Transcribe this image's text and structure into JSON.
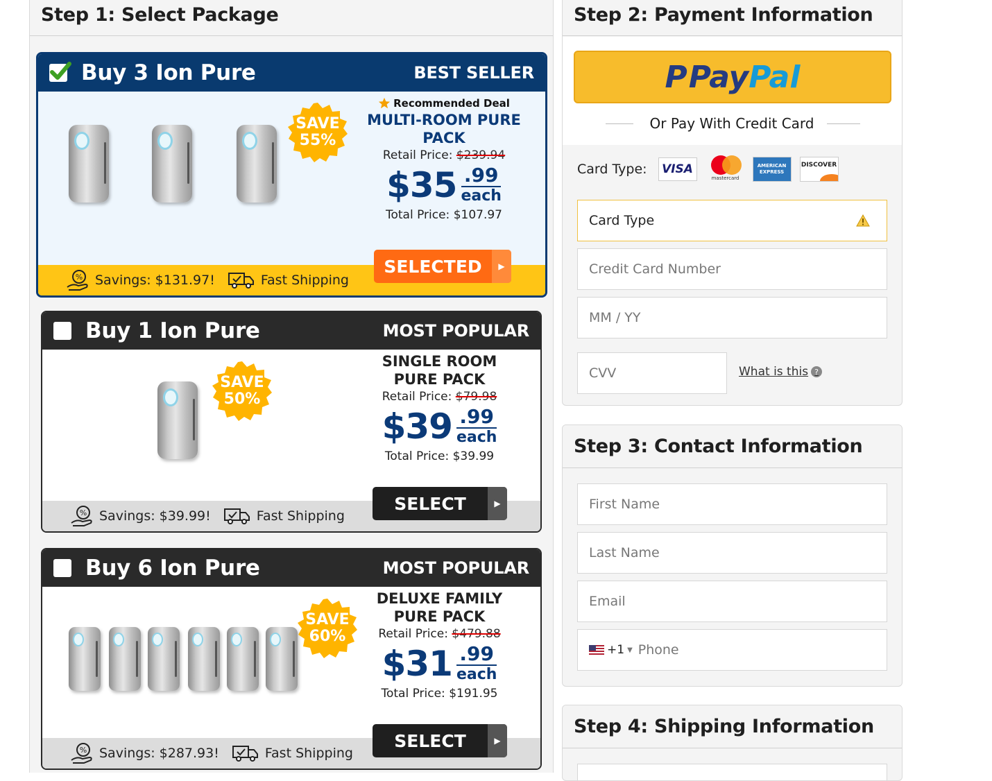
{
  "step1": {
    "title": "Step 1: Select Package"
  },
  "packages": [
    {
      "title": "Buy 3 Ion Pure",
      "tag": "BEST SELLER",
      "recommended": "Recommended Deal",
      "save_line1": "SAVE",
      "save_line2": "55%",
      "pack_name": "MULTI-ROOM PURE PACK",
      "retail_label": "Retail Price:",
      "retail_value": "$239.94",
      "price_dollars": "$35",
      "price_cents": ".99",
      "price_each": "each",
      "total": "Total Price: $107.97",
      "button": "SELECTED",
      "savings": "Savings: $131.97!",
      "shipping": "Fast Shipping",
      "selected": true,
      "device_count": 3
    },
    {
      "title": "Buy 1 Ion Pure",
      "tag": "MOST POPULAR",
      "save_line1": "SAVE",
      "save_line2": "50%",
      "pack_name": "SINGLE ROOM PURE PACK",
      "retail_label": "Retail Price:",
      "retail_value": "$79.98",
      "price_dollars": "$39",
      "price_cents": ".99",
      "price_each": "each",
      "total": "Total Price: $39.99",
      "button": "SELECT",
      "savings": "Savings: $39.99!",
      "shipping": "Fast Shipping",
      "selected": false,
      "device_count": 1
    },
    {
      "title": "Buy 6 Ion Pure",
      "tag": "MOST POPULAR",
      "save_line1": "SAVE",
      "save_line2": "60%",
      "pack_name": "DELUXE FAMILY PURE PACK",
      "retail_label": "Retail Price:",
      "retail_value": "$479.88",
      "price_dollars": "$31",
      "price_cents": ".99",
      "price_each": "each",
      "total": "Total Price: $191.95",
      "button": "SELECT",
      "savings": "Savings: $287.93!",
      "shipping": "Fast Shipping",
      "selected": false,
      "device_count": 6
    }
  ],
  "step2": {
    "title": "Step 2: Payment Information",
    "paypal_p": "P",
    "paypal_pay": "Pay",
    "paypal_pal": "Pal",
    "or_pay": "Or Pay With Credit Card",
    "card_type_label": "Card Type:",
    "card_logos": [
      "VISA",
      "mastercard",
      "AMERICAN EXPRESS",
      "DISCOVER"
    ],
    "card_type_field": "Card Type",
    "cc_placeholder": "Credit Card Number",
    "exp_placeholder": "MM / YY",
    "cvv_placeholder": "CVV",
    "what_is_this": "What is this"
  },
  "step3": {
    "title": "Step 3: Contact Information",
    "first_name": "First Name",
    "last_name": "Last Name",
    "email": "Email",
    "phone_code": "+1",
    "phone": "Phone"
  },
  "step4": {
    "title": "Step 4: Shipping Information"
  },
  "colors": {
    "navy": "#0b3a78",
    "selected_header": "#093a6f",
    "dark_header": "#2a2a2a",
    "orange": "#ff6a13",
    "yellow": "#ffc515",
    "paypal_yellow": "#f7bc2c"
  }
}
